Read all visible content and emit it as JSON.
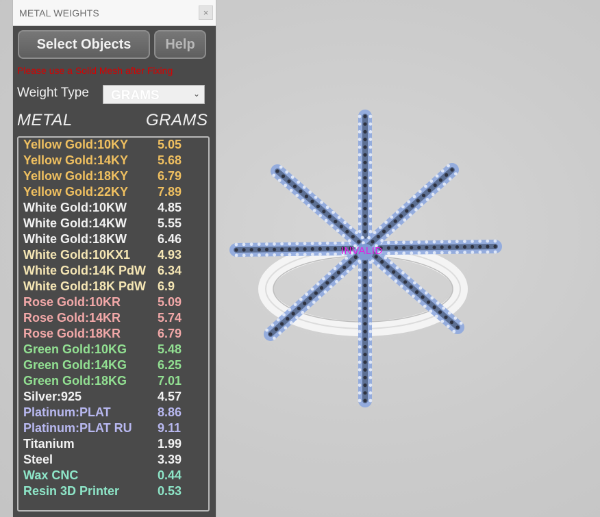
{
  "window": {
    "title": "METAL WEIGHTS",
    "close_label": "×"
  },
  "toolbar": {
    "select_label": "Select Objects",
    "help_label": "Help"
  },
  "warning": "Please use a Solid Mesh after Fixing",
  "weight_type": {
    "label": "Weight Type",
    "selected": "GRAMS"
  },
  "headers": {
    "metal": "METAL",
    "grams": "GRAMS"
  },
  "metals": [
    {
      "name": "Yellow Gold:10KY",
      "value": "5.05"
    },
    {
      "name": "Yellow Gold:14KY",
      "value": "5.68"
    },
    {
      "name": "Yellow Gold:18KY",
      "value": "6.79"
    },
    {
      "name": "Yellow Gold:22KY",
      "value": "7.89"
    },
    {
      "name": "White Gold:10KW",
      "value": "4.85"
    },
    {
      "name": "White Gold:14KW",
      "value": "5.55"
    },
    {
      "name": "White Gold:18KW",
      "value": "6.46"
    },
    {
      "name": "White Gold:10KX1",
      "value": "4.93"
    },
    {
      "name": "White Gold:14K PdW",
      "value": "6.34"
    },
    {
      "name": "White Gold:18K PdW",
      "value": "6.9"
    },
    {
      "name": "Rose Gold:10KR",
      "value": "5.09"
    },
    {
      "name": "Rose Gold:14KR",
      "value": "5.74"
    },
    {
      "name": "Rose Gold:18KR",
      "value": "6.79"
    },
    {
      "name": "Green Gold:10KG",
      "value": "5.48"
    },
    {
      "name": "Green Gold:14KG",
      "value": "6.25"
    },
    {
      "name": "Green Gold:18KG",
      "value": "7.01"
    },
    {
      "name": "Silver:925",
      "value": "4.57"
    },
    {
      "name": "Platinum:PLAT",
      "value": "8.86"
    },
    {
      "name": "Platinum:PLAT RU",
      "value": "9.11"
    },
    {
      "name": "Titanium",
      "value": "1.99"
    },
    {
      "name": "Steel",
      "value": "3.39"
    },
    {
      "name": "Wax  CNC",
      "value": "0.44"
    },
    {
      "name": "Resin 3D Printer",
      "value": "0.53"
    }
  ],
  "viewport": {
    "status_text": "INVALID"
  },
  "colors": {
    "yellow_gold": "#f0c060",
    "white_gold": "#f2f2f2",
    "palladium_white": "#f5e6b4",
    "rose_gold": "#f2a8a8",
    "green_gold": "#92e092",
    "platinum": "#b8b8f0",
    "wax_resin": "#8ee6c8",
    "warning": "#d80000",
    "invalid": "#e020e0"
  }
}
